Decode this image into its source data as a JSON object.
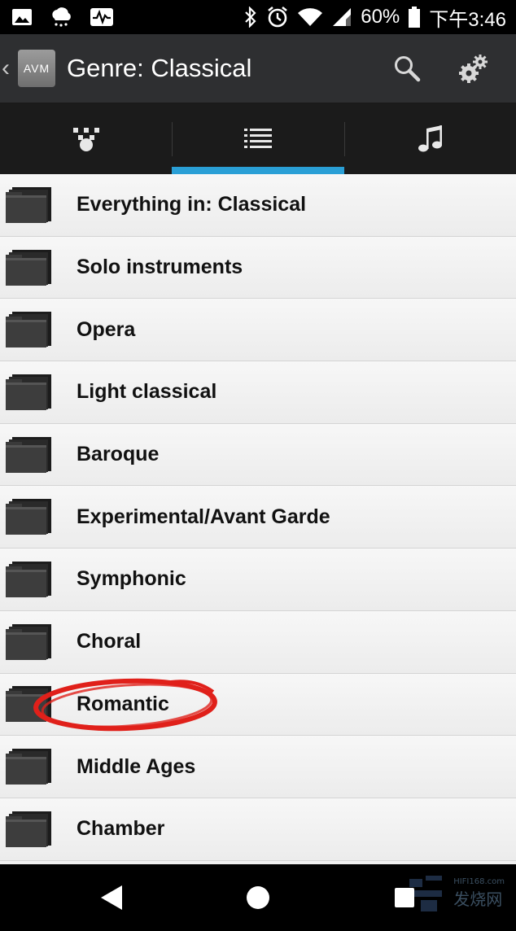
{
  "status_bar": {
    "battery_percent": "60%",
    "time": "下午3:46",
    "left_icons": [
      "image-icon",
      "weather-icon",
      "activity-icon"
    ],
    "right_icons": [
      "bluetooth-icon",
      "alarm-icon",
      "wifi-icon",
      "signal-icon",
      "battery-icon"
    ]
  },
  "app_bar": {
    "back_icon": "‹",
    "logo_text": "AVM",
    "title": "Genre: Classical",
    "actions": [
      "search-icon",
      "settings-icon"
    ]
  },
  "tabs": [
    {
      "icon": "dots-icon",
      "active": false
    },
    {
      "icon": "list-icon",
      "active": true
    },
    {
      "icon": "music-note-icon",
      "active": false
    }
  ],
  "list": {
    "items": [
      {
        "label": "Everything in: Classical"
      },
      {
        "label": "Solo instruments"
      },
      {
        "label": "Opera"
      },
      {
        "label": "Light classical"
      },
      {
        "label": "Baroque"
      },
      {
        "label": "Experimental/Avant Garde"
      },
      {
        "label": "Symphonic"
      },
      {
        "label": "Choral"
      },
      {
        "label": "Romantic",
        "highlighted": true
      },
      {
        "label": "Middle Ages"
      },
      {
        "label": "Chamber"
      }
    ]
  },
  "nav_bar": {
    "buttons": [
      "back-icon",
      "home-icon",
      "recents-icon"
    ],
    "watermark_url": "HIFI168.com",
    "watermark_text": "发烧网"
  },
  "colors": {
    "app_bar": "#2e2f31",
    "tab_bar": "#1b1b1b",
    "tab_indicator": "#2a9fd6",
    "list_bg": "#f0f0f0",
    "highlight_circle": "#e0201a"
  }
}
